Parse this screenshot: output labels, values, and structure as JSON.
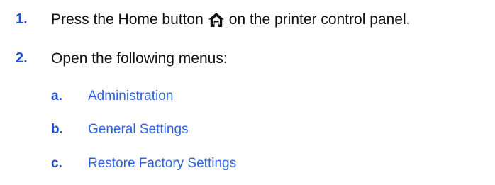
{
  "steps": [
    {
      "number": "1.",
      "text_before": "Press the Home button",
      "icon": "home-icon",
      "text_after": "on the printer control panel."
    },
    {
      "number": "2.",
      "text": "Open the following menus:"
    }
  ],
  "substeps": [
    {
      "letter": "a.",
      "label": "Administration"
    },
    {
      "letter": "b.",
      "label": "General Settings"
    },
    {
      "letter": "c.",
      "label": "Restore Factory Settings"
    }
  ],
  "colors": {
    "number": "#1f4fd6",
    "link": "#2b63e0",
    "text": "#111111"
  }
}
